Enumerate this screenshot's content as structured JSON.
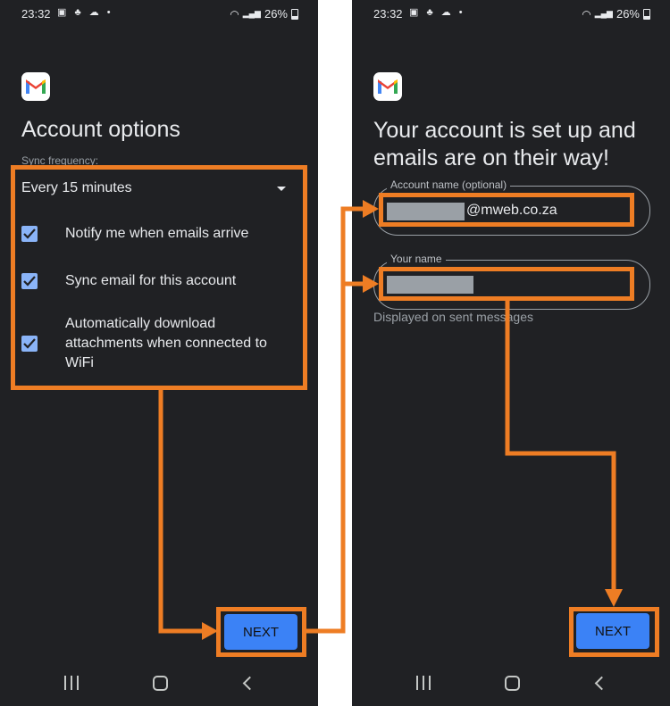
{
  "left_screen": {
    "status": {
      "time": "23:32",
      "battery": "26%"
    },
    "title": "Account options",
    "sync_label": "Sync frequency:",
    "sync_value": "Every 15 minutes",
    "options": [
      {
        "label_lines": [
          "Notify me when emails arrive"
        ],
        "checked": true
      },
      {
        "label_lines": [
          "Sync email for this account"
        ],
        "checked": true
      },
      {
        "label_lines": [
          "Automatically download",
          "attachments when connected to",
          "WiFi"
        ],
        "checked": true
      }
    ],
    "next_label": "NEXT"
  },
  "right_screen": {
    "status": {
      "time": "23:32",
      "battery": "26%"
    },
    "title_lines": [
      "Your account is set up and",
      "emails are on their way!"
    ],
    "account_name_label": "Account name (optional)",
    "account_name_value": "@mweb.co.za",
    "your_name_label": "Your name",
    "your_name_helper": "Displayed on sent messages",
    "next_label": "NEXT"
  },
  "colors": {
    "phone_bg": "#202124",
    "annotation": "#ee7d24",
    "checkbox": "#8ab4f8",
    "button": "#3b82f6",
    "gmail_red": "#ea4335",
    "gmail_blue": "#4285f4",
    "gmail_green": "#34a853",
    "gmail_yellow": "#fbbc04"
  },
  "icons": {
    "logo": "gmail-logo",
    "dropdown": "dropdown-arrow-icon",
    "check": "checkbox-check-icon",
    "nav": [
      "recents-icon",
      "home-icon",
      "back-icon"
    ]
  }
}
